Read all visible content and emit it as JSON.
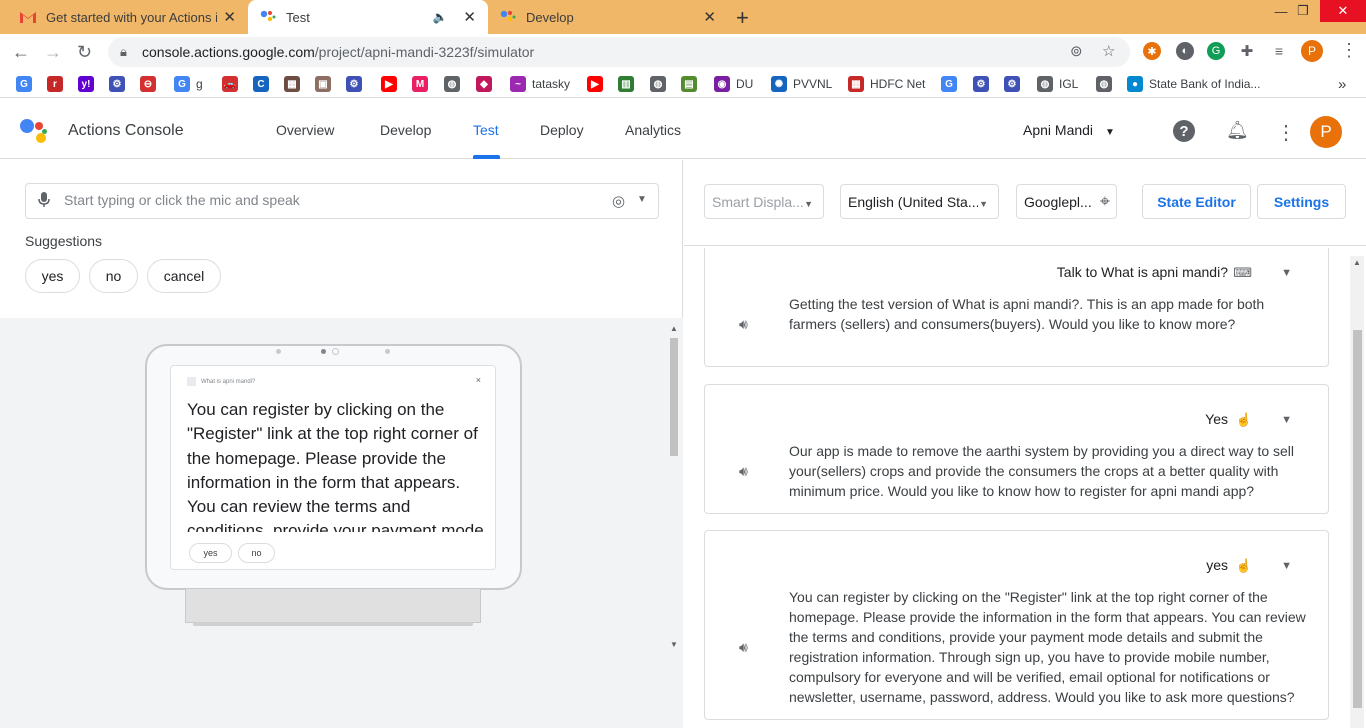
{
  "browser": {
    "tabs": [
      {
        "title": "Get started with your Actions in r",
        "icon": "gmail-icon"
      },
      {
        "title": "Test",
        "icon": "actions-icon",
        "audio": "speaker-icon"
      },
      {
        "title": "Develop",
        "icon": "actions-icon"
      }
    ],
    "new_tab": "+",
    "window_controls": {
      "minimize": "—",
      "maximize": "❐",
      "close": "✕"
    },
    "url_host": "console.actions.google.com",
    "url_path": "/project/apni-mandi-3223f/simulator",
    "profile_initial": "P",
    "bookmarks": [
      {
        "label": "",
        "icon": "google-icon",
        "color": "#4285f4",
        "glyph": "G"
      },
      {
        "label": "",
        "icon": "rediff-icon",
        "color": "#c62828",
        "glyph": "r"
      },
      {
        "label": "",
        "icon": "yahoo-icon",
        "color": "#6001d2",
        "glyph": "y!"
      },
      {
        "label": "",
        "icon": "gov-icon",
        "color": "#3f51b5",
        "glyph": "⚙"
      },
      {
        "label": "",
        "icon": "rail-icon",
        "color": "#d32f2f",
        "glyph": "⊖"
      },
      {
        "label": "g",
        "icon": "google-icon",
        "color": "#4285f4",
        "glyph": "G"
      },
      {
        "label": "",
        "icon": "car-icon",
        "color": "#d32f2f",
        "glyph": "🚗"
      },
      {
        "label": "",
        "icon": "clue-icon",
        "color": "#1565c0",
        "glyph": "C"
      },
      {
        "label": "",
        "icon": "app-icon",
        "color": "#6d4c41",
        "glyph": "▦"
      },
      {
        "label": "",
        "icon": "image-icon",
        "color": "#8d6e63",
        "glyph": "▣"
      },
      {
        "label": "",
        "icon": "gov-icon",
        "color": "#3f51b5",
        "glyph": "⚙"
      },
      {
        "label": "",
        "icon": "youtube-icon",
        "color": "#ff0000",
        "glyph": "▶"
      },
      {
        "label": "",
        "icon": "myntra-icon",
        "color": "#e91e63",
        "glyph": "M"
      },
      {
        "label": "",
        "icon": "globe-icon",
        "color": "#5f6368",
        "glyph": "◍"
      },
      {
        "label": "",
        "icon": "bookmark-red-icon",
        "color": "#c2185b",
        "glyph": "◆"
      },
      {
        "label": "tatasky",
        "icon": "tatasky-icon",
        "color": "#9c27b0",
        "glyph": "~"
      },
      {
        "label": "",
        "icon": "youtube-icon",
        "color": "#ff0000",
        "glyph": "▶"
      },
      {
        "label": "",
        "icon": "bank-icon",
        "color": "#2e7d32",
        "glyph": "▥"
      },
      {
        "label": "",
        "icon": "globe-icon",
        "color": "#5f6368",
        "glyph": "◍"
      },
      {
        "label": "",
        "icon": "card-icon",
        "color": "#558b2f",
        "glyph": "▤"
      },
      {
        "label": "DU",
        "icon": "du-icon",
        "color": "#7b1fa2",
        "glyph": "◉"
      },
      {
        "label": "PVVNL",
        "icon": "pvvnl-icon",
        "color": "#1565c0",
        "glyph": "✺"
      },
      {
        "label": "HDFC Net",
        "icon": "hdfc-icon",
        "color": "#c62828",
        "glyph": "▦"
      },
      {
        "label": "",
        "icon": "google-icon",
        "color": "#4285f4",
        "glyph": "G"
      },
      {
        "label": "",
        "icon": "gov-icon",
        "color": "#3f51b5",
        "glyph": "⚙"
      },
      {
        "label": "",
        "icon": "gov-icon",
        "color": "#3f51b5",
        "glyph": "⚙"
      },
      {
        "label": "IGL",
        "icon": "globe-icon",
        "color": "#5f6368",
        "glyph": "◍"
      },
      {
        "label": "",
        "icon": "globe-icon",
        "color": "#5f6368",
        "glyph": "◍"
      },
      {
        "label": "State Bank of India...",
        "icon": "sbi-icon",
        "color": "#0288d1",
        "glyph": "●"
      }
    ],
    "bookmarks_more": "»"
  },
  "app": {
    "title": "Actions Console",
    "nav": [
      "Overview",
      "Develop",
      "Test",
      "Deploy",
      "Analytics"
    ],
    "active_tab": "Test",
    "project": "Apni Mandi",
    "avatar_initial": "P"
  },
  "simulator": {
    "input_placeholder": "Start typing or click the mic and speak",
    "suggestions_label": "Suggestions",
    "suggestions": [
      "yes",
      "no",
      "cancel"
    ],
    "device": {
      "header": "What is apni mandi?",
      "close": "×",
      "text": "You can register by clicking on the \"Register\" link at the top right corner of the homepage. Please provide the information in the form that appears. You can review the terms and conditions, provide your payment mode details and submit",
      "chips": [
        "yes",
        "no"
      ]
    }
  },
  "controls": {
    "surface": "Smart Displa...",
    "language": "English (United Sta...",
    "location": "Googlepl...",
    "state_editor": "State Editor",
    "settings": "Settings"
  },
  "conversation": [
    {
      "user": "Talk to What is apni mandi?",
      "user_icon": "keyboard-icon",
      "response": "Getting the test version of What is apni mandi?. This is an app made for both farmers (sellers) and consumers(buyers). Would you like to know more?"
    },
    {
      "user": "Yes",
      "user_icon": "touch-icon",
      "response": "Our app is made to remove the aarthi system by providing you a direct way to sell your(sellers) crops and provide the consumers the crops at a better quality with minimum price. Would you like to know how to register for apni mandi app?"
    },
    {
      "user": "yes",
      "user_icon": "touch-icon",
      "response": "You can register by clicking on the \"Register\" link at the top right corner of the homepage. Please provide the information in the form that appears. You can review the terms and conditions, provide your payment mode details and submit the registration information. Through sign up, you have to provide mobile number, compulsory for everyone and will be verified, email optional for notifications or newsletter, username, password, address. Would you like to ask more questions?"
    }
  ]
}
